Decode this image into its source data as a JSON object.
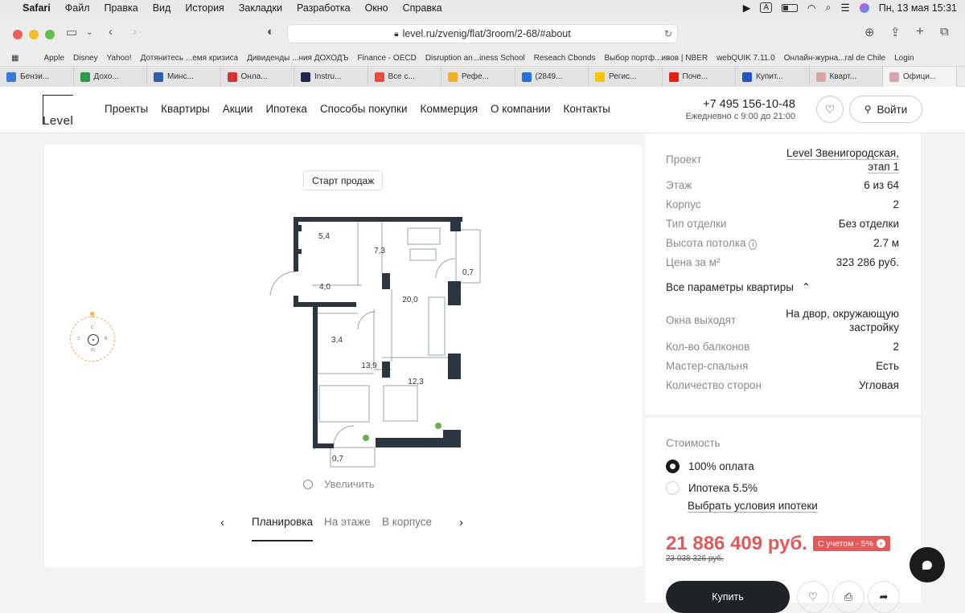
{
  "menubar": {
    "app": "Safari",
    "items": [
      "Файл",
      "Правка",
      "Вид",
      "История",
      "Закладки",
      "Разработка",
      "Окно",
      "Справка"
    ],
    "input_badge": "A",
    "datetime": "Пн, 13 мая  15:31"
  },
  "browser": {
    "url": "level.ru/zvenig/flat/3room/2-68/#about",
    "bookmarks": [
      "Apple",
      "Disney",
      "Yahoo!",
      "Дотянитесь ...емя кризиса",
      "Дивиденды ...ния ДОХОДЪ",
      "Finance - OECD",
      "Disruption an...iness School",
      "Reseach Cbonds",
      "Выбор портф...ивов | NBER",
      "webQUIK 7.11.0",
      "Онлайн-журна...ral de Chile",
      "Login"
    ],
    "tabs": [
      {
        "label": "Бензи...",
        "color": "#3b7bd8"
      },
      {
        "label": "Дохо...",
        "color": "#2e9a4b"
      },
      {
        "label": "Минс...",
        "color": "#2f5fa8"
      },
      {
        "label": "Онла...",
        "color": "#d2323a"
      },
      {
        "label": "Instru...",
        "color": "#1b2a4a"
      },
      {
        "label": "Все с...",
        "color": "#e74b3c"
      },
      {
        "label": "Рефе...",
        "color": "#f2b02a"
      },
      {
        "label": "(2849...",
        "color": "#2a6fd6"
      },
      {
        "label": "Регис...",
        "color": "#f6c400"
      },
      {
        "label": "Поче...",
        "color": "#e62117"
      },
      {
        "label": "Купит...",
        "color": "#2354c7"
      },
      {
        "label": "Кварт...",
        "color": "#d7a7a7"
      },
      {
        "label": "Офици...",
        "color": "#d7a7a7"
      }
    ]
  },
  "site": {
    "logo": "Level",
    "nav": [
      "Проекты",
      "Квартиры",
      "Акции",
      "Ипотека",
      "Способы покупки",
      "Коммерция",
      "О компании",
      "Контакты"
    ],
    "phone": "+7 495 156-10-48",
    "hours": "Ежедневно с 9:00 до 21:00",
    "login": "Войти"
  },
  "plan": {
    "badge": "Старт продаж",
    "zoom": "Увеличить",
    "tabs": [
      "Планировка",
      "На этаже",
      "В корпусе"
    ],
    "rooms": [
      "5,4",
      "7,3",
      "0,7",
      "4,0",
      "20,0",
      "3,4",
      "13,9",
      "12,3",
      "0,7"
    ],
    "compass": [
      "С",
      "З",
      "В",
      "Ю"
    ]
  },
  "params": {
    "rows": [
      {
        "k": "Проект",
        "v1": "Level Звенигородская,",
        "v2": "этап 1"
      },
      {
        "k": "Этаж",
        "v": "6 из 64"
      },
      {
        "k": "Корпус",
        "v": "2"
      },
      {
        "k": "Тип отделки",
        "v": "Без отделки"
      },
      {
        "k": "Высота потолка",
        "v": "2.7 м"
      },
      {
        "k": "Цена за м²",
        "v": "323 286 руб."
      }
    ],
    "toggle": "Все параметры квартиры",
    "rows2": [
      {
        "k": "Окна выходят",
        "v1": "На двор, окружающую",
        "v2": "застройку"
      },
      {
        "k": "Кол-во балконов",
        "v": "2"
      },
      {
        "k": "Мастер-спальня",
        "v": "Есть"
      },
      {
        "k": "Количество сторон",
        "v": "Угловая"
      }
    ]
  },
  "price": {
    "label": "Стоимость",
    "option1": "100% оплата",
    "option2": "Ипотека 5.5%",
    "mortgage_link": "Выбрать условия ипотеки",
    "price": "21 886 409 руб.",
    "old_price": "23 038 326 руб.",
    "discount": "С учетом - 5%",
    "buy": "Купить"
  }
}
